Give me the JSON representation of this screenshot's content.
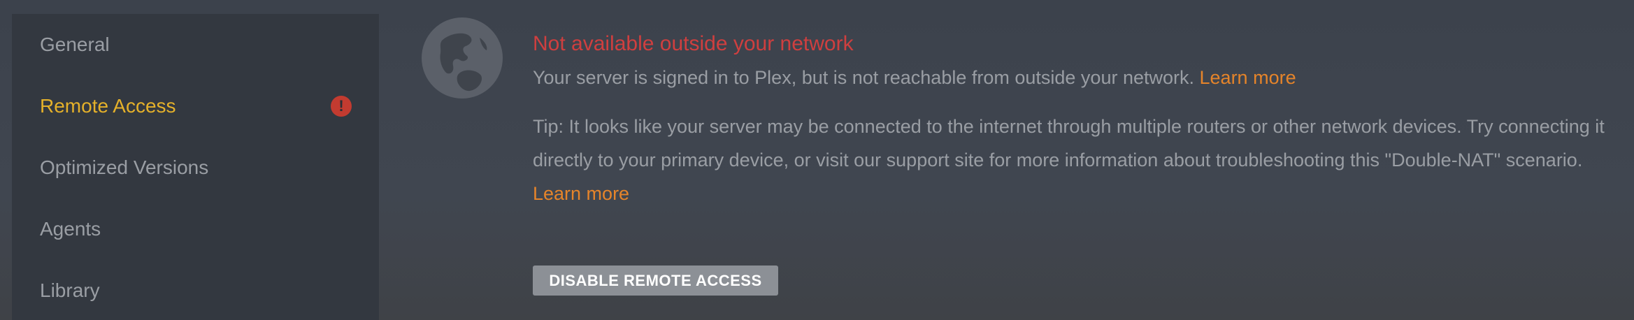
{
  "sidebar": {
    "items": [
      {
        "label": "General"
      },
      {
        "label": "Remote Access",
        "active": true,
        "badge": "!"
      },
      {
        "label": "Optimized Versions"
      },
      {
        "label": "Agents"
      },
      {
        "label": "Library"
      }
    ]
  },
  "status": {
    "icon": "globe-icon",
    "title": "Not available outside your network",
    "message": "Your server is signed in to Plex, but is not reachable from outside your network.",
    "message_link": "Learn more",
    "tip": "Tip: It looks like your server may be connected to the internet through multiple routers or other network devices. Try connecting it directly to your primary device, or visit our support site for more information about troubleshooting this \"Double-NAT\" scenario.",
    "tip_link": "Learn more"
  },
  "actions": {
    "disable_label": "DISABLE REMOTE ACCESS"
  },
  "colors": {
    "accent": "#e5b12a",
    "error": "#cf3f3f",
    "link": "#e5842a"
  }
}
